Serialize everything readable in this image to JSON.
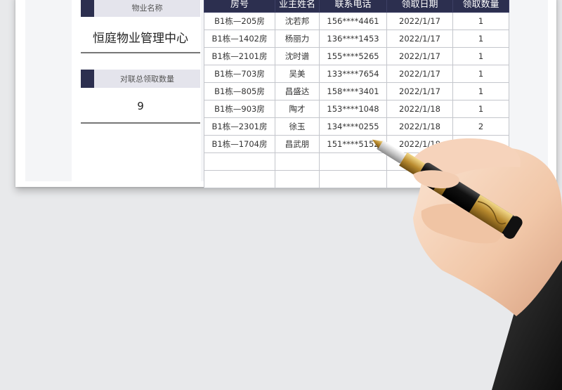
{
  "property_label": "物业名称",
  "property_name": "恒庭物业管理中心",
  "total_label": "对联总领取数量",
  "total_value": "9",
  "table": {
    "headers": [
      "房号",
      "业主姓名",
      "联系电话",
      "领取日期",
      "领取数量"
    ],
    "rows": [
      [
        "B1栋—205房",
        "沈若邦",
        "156****4461",
        "2022/1/17",
        "1"
      ],
      [
        "B1栋—1402房",
        "杨丽力",
        "136****1453",
        "2022/1/17",
        "1"
      ],
      [
        "B1栋—2101房",
        "沈时谱",
        "155****5265",
        "2022/1/17",
        "1"
      ],
      [
        "B1栋—703房",
        "吴美",
        "133****7654",
        "2022/1/17",
        "1"
      ],
      [
        "B1栋—805房",
        "昌盛达",
        "158****3401",
        "2022/1/17",
        "1"
      ],
      [
        "B1栋—903房",
        "陶才",
        "153****1048",
        "2022/1/18",
        "1"
      ],
      [
        "B1栋—2301房",
        "徐玉",
        "134****0255",
        "2022/1/18",
        "2"
      ],
      [
        "B1栋—1704房",
        "昌武朋",
        "151****5152",
        "2022/1/18",
        ""
      ],
      [
        "",
        "",
        "",
        "",
        ""
      ],
      [
        "",
        "",
        "",
        "",
        ""
      ]
    ]
  },
  "colors": {
    "header_bg": "#2c2f4f",
    "label_bg": "#e4e4ec",
    "background": "#e8e9eb"
  }
}
